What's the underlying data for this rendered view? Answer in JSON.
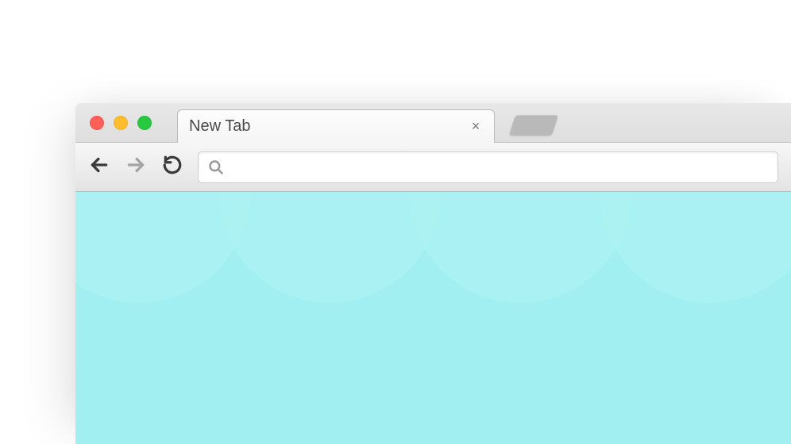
{
  "window": {
    "traffic_lights": {
      "close_color": "#ff5f57",
      "minimize_color": "#ffbd2e",
      "maximize_color": "#28c941"
    }
  },
  "tabs": {
    "active": {
      "title": "New Tab",
      "close_glyph": "×"
    }
  },
  "toolbar": {
    "back_icon": "arrow-left",
    "forward_icon": "arrow-right",
    "reload_icon": "reload"
  },
  "omnibox": {
    "search_icon": "search",
    "value": "",
    "placeholder": ""
  },
  "viewport": {
    "background_color": "#a1eff0"
  }
}
